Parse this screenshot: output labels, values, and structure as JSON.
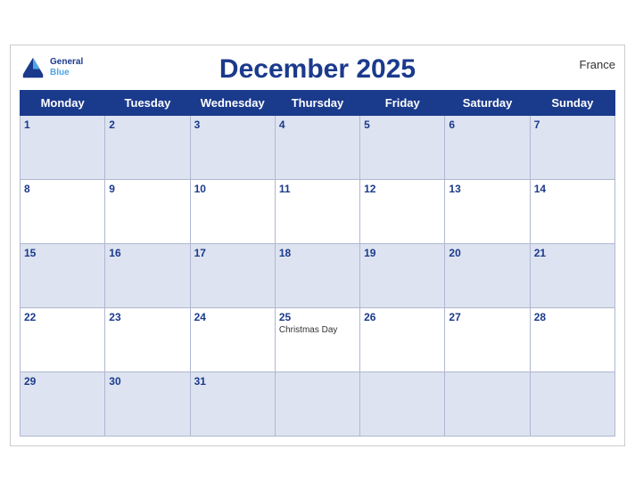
{
  "calendar": {
    "title": "December 2025",
    "country": "France",
    "logo": {
      "general": "General",
      "blue": "Blue"
    },
    "days_of_week": [
      "Monday",
      "Tuesday",
      "Wednesday",
      "Thursday",
      "Friday",
      "Saturday",
      "Sunday"
    ],
    "weeks": [
      [
        {
          "date": "1",
          "holiday": ""
        },
        {
          "date": "2",
          "holiday": ""
        },
        {
          "date": "3",
          "holiday": ""
        },
        {
          "date": "4",
          "holiday": ""
        },
        {
          "date": "5",
          "holiday": ""
        },
        {
          "date": "6",
          "holiday": ""
        },
        {
          "date": "7",
          "holiday": ""
        }
      ],
      [
        {
          "date": "8",
          "holiday": ""
        },
        {
          "date": "9",
          "holiday": ""
        },
        {
          "date": "10",
          "holiday": ""
        },
        {
          "date": "11",
          "holiday": ""
        },
        {
          "date": "12",
          "holiday": ""
        },
        {
          "date": "13",
          "holiday": ""
        },
        {
          "date": "14",
          "holiday": ""
        }
      ],
      [
        {
          "date": "15",
          "holiday": ""
        },
        {
          "date": "16",
          "holiday": ""
        },
        {
          "date": "17",
          "holiday": ""
        },
        {
          "date": "18",
          "holiday": ""
        },
        {
          "date": "19",
          "holiday": ""
        },
        {
          "date": "20",
          "holiday": ""
        },
        {
          "date": "21",
          "holiday": ""
        }
      ],
      [
        {
          "date": "22",
          "holiday": ""
        },
        {
          "date": "23",
          "holiday": ""
        },
        {
          "date": "24",
          "holiday": ""
        },
        {
          "date": "25",
          "holiday": "Christmas Day"
        },
        {
          "date": "26",
          "holiday": ""
        },
        {
          "date": "27",
          "holiday": ""
        },
        {
          "date": "28",
          "holiday": ""
        }
      ],
      [
        {
          "date": "29",
          "holiday": ""
        },
        {
          "date": "30",
          "holiday": ""
        },
        {
          "date": "31",
          "holiday": ""
        },
        {
          "date": "",
          "holiday": ""
        },
        {
          "date": "",
          "holiday": ""
        },
        {
          "date": "",
          "holiday": ""
        },
        {
          "date": "",
          "holiday": ""
        }
      ]
    ]
  }
}
